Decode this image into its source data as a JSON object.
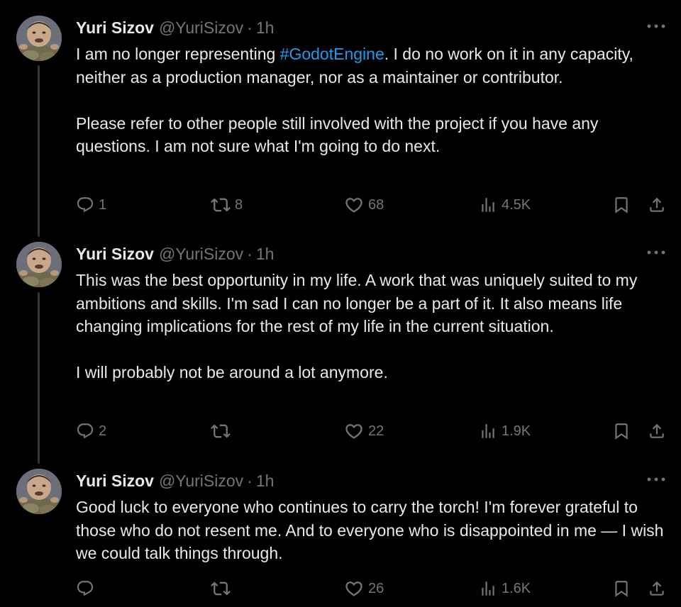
{
  "tweets": [
    {
      "author": {
        "name": "Yuri Sizov",
        "handle": "@YuriSizov",
        "time": "1h"
      },
      "text_before_hashtag": "I am no longer representing ",
      "hashtag": "#GodotEngine",
      "text_after_hashtag": ". I do no work on it in any capacity, neither as a production manager, nor as a maintainer or contributor.",
      "paragraph2": "Please refer to other people still involved with the project if you have any questions. I am not sure what I'm going to do next.",
      "metrics": {
        "replies": "1",
        "reposts": "8",
        "likes": "68",
        "views": "4.5K"
      }
    },
    {
      "author": {
        "name": "Yuri Sizov",
        "handle": "@YuriSizov",
        "time": "1h"
      },
      "paragraph1": "This was the best opportunity in my life. A work that was uniquely suited to my ambitions and skills. I'm sad I can no longer be a part of it. It also means life changing implications for the rest of my life in the current situation.",
      "paragraph2": "I will probably not be around a lot anymore.",
      "metrics": {
        "replies": "2",
        "reposts": "",
        "likes": "22",
        "views": "1.9K"
      }
    },
    {
      "author": {
        "name": "Yuri Sizov",
        "handle": "@YuriSizov",
        "time": "1h"
      },
      "paragraph1": "Good luck to everyone who continues to carry the torch! I'm forever grateful to those who do not resent me. And to everyone who is disappointed in me — I wish we could talk things through.",
      "metrics": {
        "replies": "",
        "reposts": "",
        "likes": "26",
        "views": "1.6K"
      }
    }
  ],
  "separator": "·",
  "colors": {
    "background": "#000000",
    "text": "#e7e9ea",
    "muted": "#71767b",
    "link": "#1d9bf0",
    "thread_line": "#333639"
  },
  "icons": [
    "more-icon",
    "reply-icon",
    "repost-icon",
    "like-icon",
    "views-icon",
    "bookmark-icon",
    "share-icon"
  ]
}
